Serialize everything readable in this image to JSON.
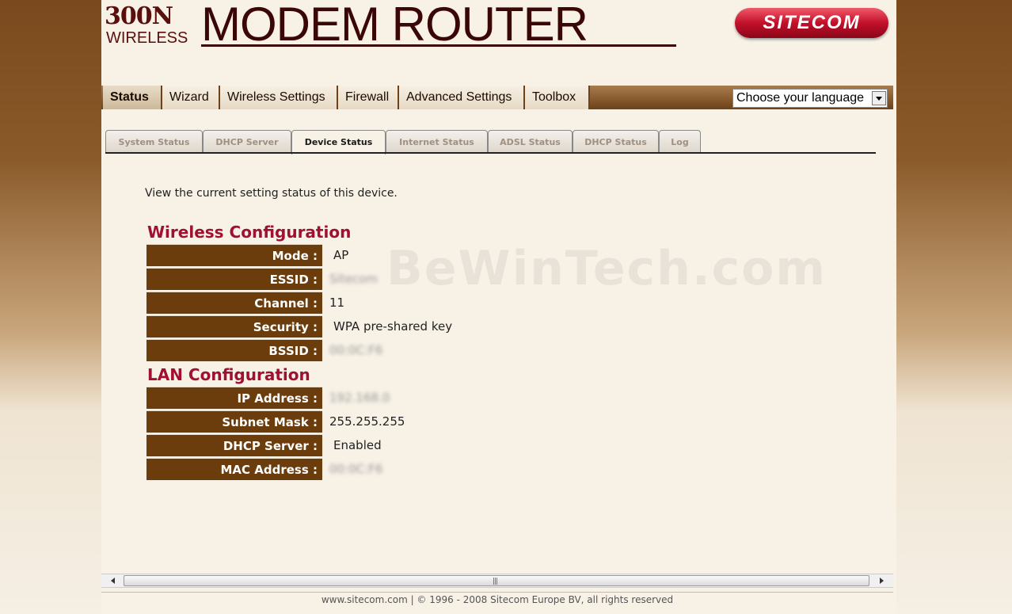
{
  "header": {
    "logo_300n": "300N",
    "logo_wireless": "WIRELESS",
    "title": "MODEM ROUTER",
    "brand": "SITECOM"
  },
  "nav": {
    "items": [
      {
        "label": "Status",
        "active": true
      },
      {
        "label": "Wizard",
        "active": false
      },
      {
        "label": "Wireless Settings",
        "active": false
      },
      {
        "label": "Firewall",
        "active": false
      },
      {
        "label": "Advanced Settings",
        "active": false
      },
      {
        "label": "Toolbox",
        "active": false
      }
    ],
    "language_label": "Choose your language"
  },
  "tabs": [
    {
      "label": "System Status",
      "active": false
    },
    {
      "label": "DHCP Server",
      "active": false
    },
    {
      "label": "Device Status",
      "active": true
    },
    {
      "label": "Internet Status",
      "active": false
    },
    {
      "label": "ADSL Status",
      "active": false
    },
    {
      "label": "DHCP Status",
      "active": false
    },
    {
      "label": "Log",
      "active": false
    }
  ],
  "intro": "View the current setting status of this device.",
  "wireless": {
    "title": "Wireless Configuration",
    "rows": [
      {
        "label": "Mode :",
        "value": "AP"
      },
      {
        "label": "ESSID :",
        "value": "Sitecom"
      },
      {
        "label": "Channel :",
        "value": "11"
      },
      {
        "label": "Security :",
        "value": "WPA pre-shared key"
      },
      {
        "label": "BSSID :",
        "value": "00:0C:F6"
      }
    ]
  },
  "lan": {
    "title": "LAN Configuration",
    "rows": [
      {
        "label": "IP Address :",
        "value": "192.168.0"
      },
      {
        "label": "Subnet Mask :",
        "value": "255.255.255"
      },
      {
        "label": "DHCP Server :",
        "value": "Enabled"
      },
      {
        "label": "MAC Address :",
        "value": "00:0C:F6"
      }
    ]
  },
  "watermark": "BeWinTech.com",
  "footer": "www.sitecom.com | © 1996 - 2008 Sitecom Europe BV, all rights reserved"
}
